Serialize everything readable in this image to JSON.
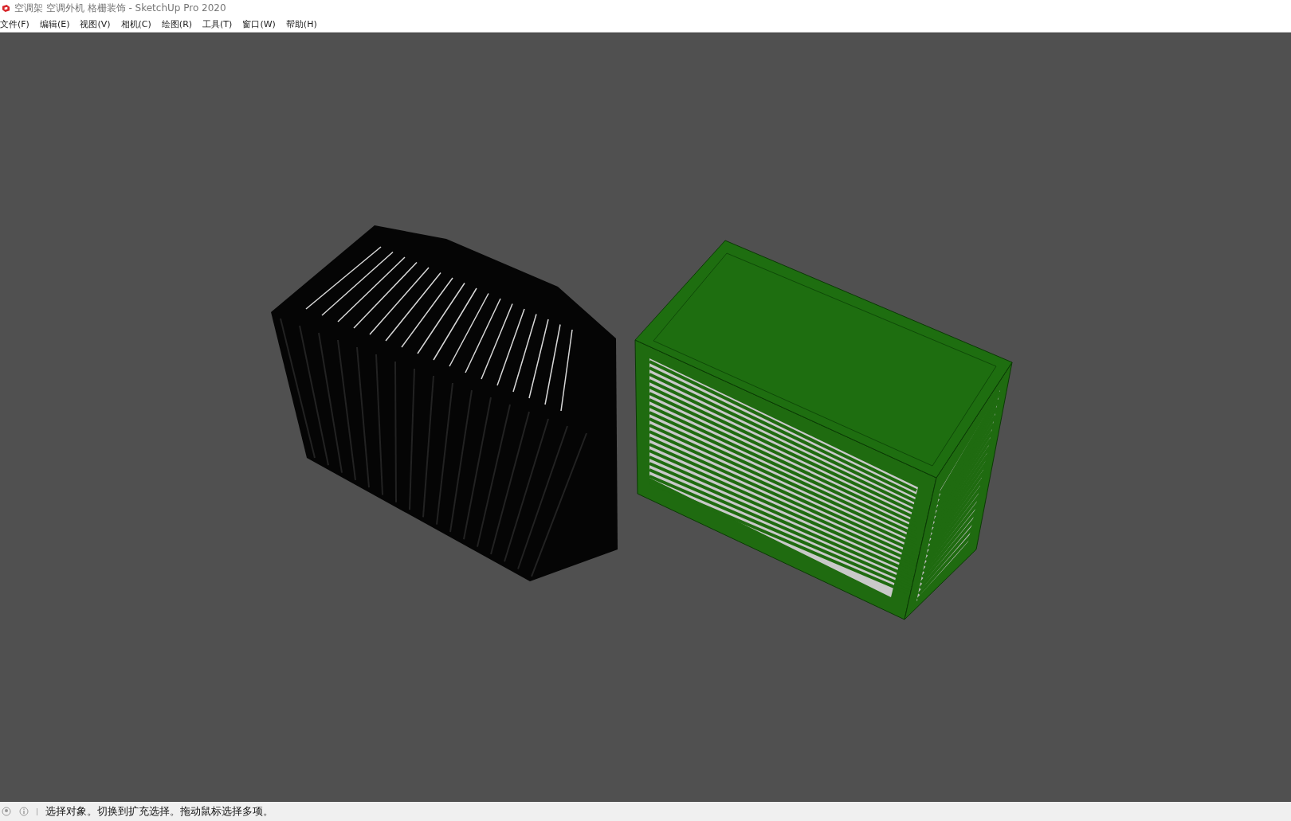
{
  "window": {
    "title": "空调架 空调外机 格栅装饰 - SketchUp Pro 2020"
  },
  "menu": [
    "文件(F)",
    "编辑(E)",
    "视图(V)",
    "相机(C)",
    "绘图(R)",
    "工具(T)",
    "窗口(W)",
    "帮助(H)"
  ],
  "status_bar": {
    "text": "选择对象。切换到扩充选择。拖动鼠标选择多项。"
  }
}
